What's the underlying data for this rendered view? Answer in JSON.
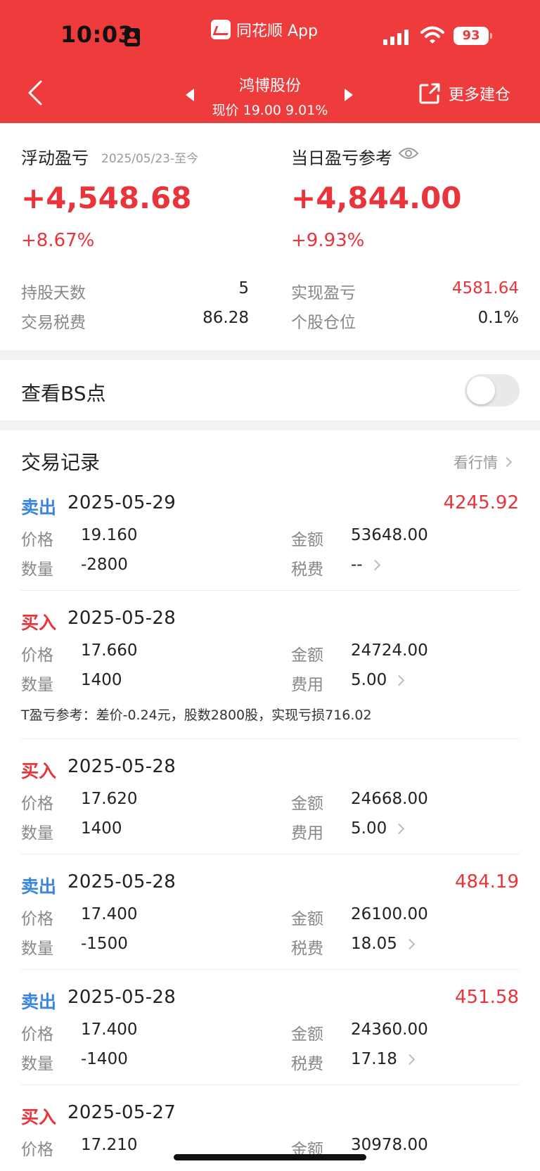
{
  "status_bar": {
    "time": "10:03",
    "battery": "93"
  },
  "header": {
    "app_name": "同花顺 App",
    "stock_name": "鸿博股份",
    "price_line": "现价 19.00 9.01%",
    "more_label": "更多建仓"
  },
  "summary": {
    "floating_title": "浮动盈亏",
    "floating_date": "2025/05/23-至今",
    "floating_value": "+4,548.68",
    "floating_pct": "+8.67%",
    "daily_title": "当日盈亏参考",
    "daily_value": "+4,844.00",
    "daily_pct": "+9.93%",
    "left_stats": [
      {
        "label": "持股天数",
        "value": "5"
      },
      {
        "label": "交易税费",
        "value": "86.28"
      }
    ],
    "right_stats": [
      {
        "label": "实现盈亏",
        "value": "4581.64"
      },
      {
        "label": "个股仓位",
        "value": "0.1%"
      }
    ]
  },
  "bs_point": {
    "label": "查看BS点",
    "enabled": false
  },
  "records": {
    "title": "交易记录",
    "market_link": "看行情",
    "items": [
      {
        "type": "卖出",
        "date": "2025-05-29",
        "profit": "4245.92",
        "price_label": "价格",
        "price": "19.160",
        "qty_label": "数量",
        "qty": "-2800",
        "amount_label": "金额",
        "amount": "53648.00",
        "fee_label": "税费",
        "fee": "--"
      },
      {
        "type": "买入",
        "date": "2025-05-28",
        "profit": "",
        "price_label": "价格",
        "price": "17.660",
        "qty_label": "数量",
        "qty": "1400",
        "amount_label": "金额",
        "amount": "24724.00",
        "fee_label": "费用",
        "fee": "5.00",
        "note": "T盈亏参考：差价-0.24元，股数2800股，实现亏损716.02"
      },
      {
        "type": "买入",
        "date": "2025-05-28",
        "profit": "",
        "price_label": "价格",
        "price": "17.620",
        "qty_label": "数量",
        "qty": "1400",
        "amount_label": "金额",
        "amount": "24668.00",
        "fee_label": "费用",
        "fee": "5.00"
      },
      {
        "type": "卖出",
        "date": "2025-05-28",
        "profit": "484.19",
        "price_label": "价格",
        "price": "17.400",
        "qty_label": "数量",
        "qty": "-1500",
        "amount_label": "金额",
        "amount": "26100.00",
        "fee_label": "税费",
        "fee": "18.05"
      },
      {
        "type": "卖出",
        "date": "2025-05-28",
        "profit": "451.58",
        "price_label": "价格",
        "price": "17.400",
        "qty_label": "数量",
        "qty": "-1400",
        "amount_label": "金额",
        "amount": "24360.00",
        "fee_label": "税费",
        "fee": "17.18"
      },
      {
        "type": "买入",
        "date": "2025-05-27",
        "profit": "",
        "price_label": "价格",
        "price": "17.210",
        "amount_label": "金额",
        "amount": "30978.00"
      }
    ]
  },
  "colors": {
    "header_red": "#ee3b3b",
    "profit_red": "#e8343a",
    "sell_blue": "#3a86e0"
  }
}
